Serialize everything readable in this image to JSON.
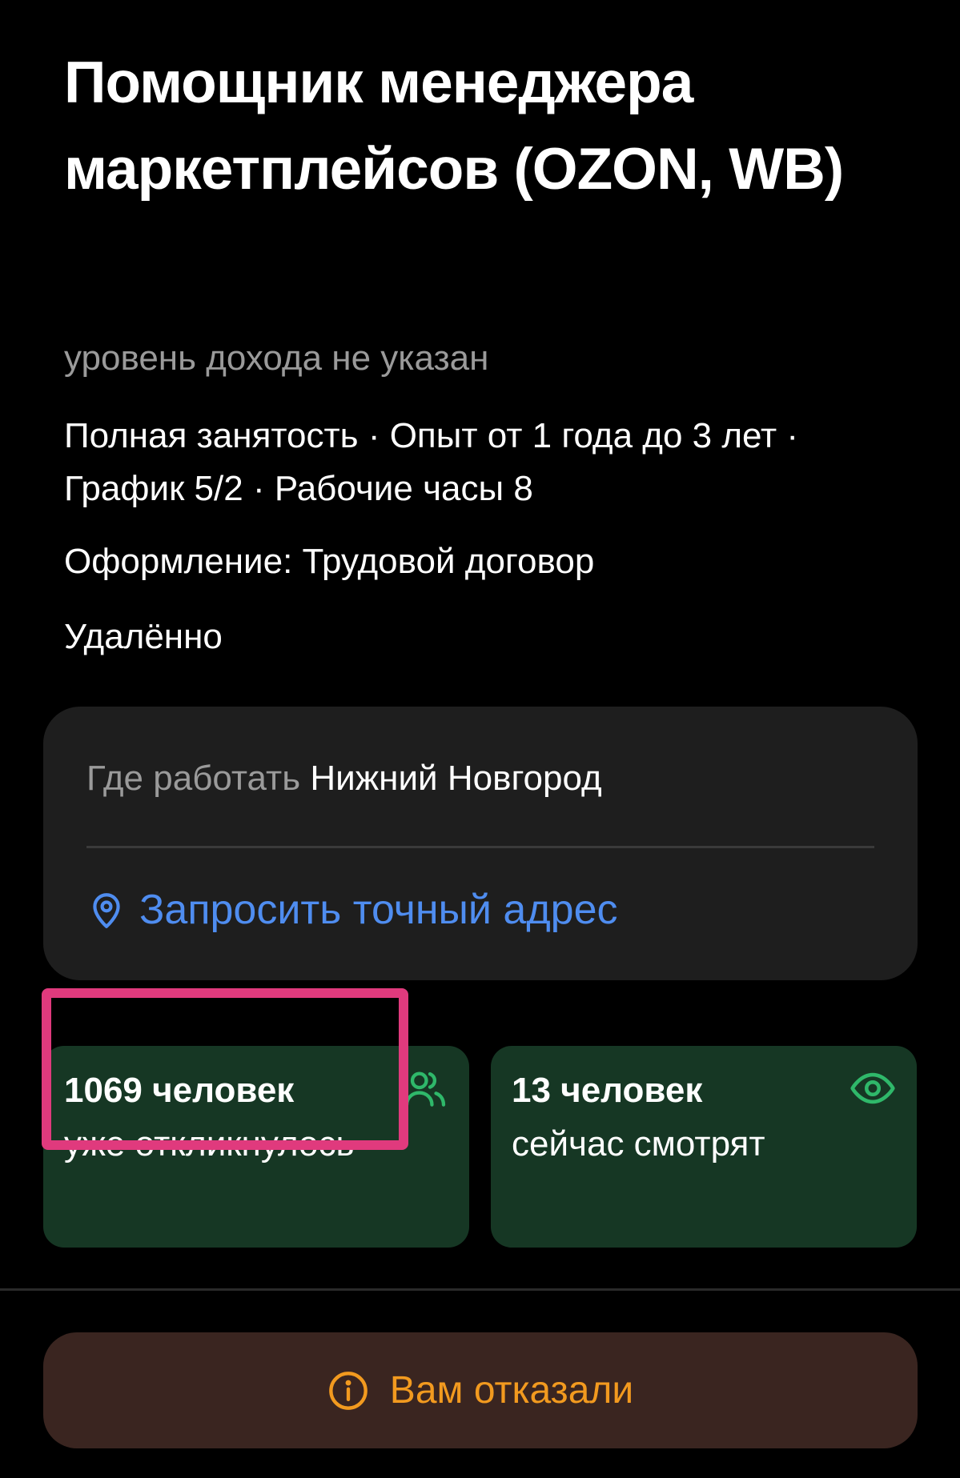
{
  "vacancy": {
    "title": "Помощник менеджера маркетплейсов (OZON, WB)",
    "salary": "уровень дохода не указан",
    "details": "Полная занятость · Опыт от 1 года до 3 лет · График 5/2 · Рабочие часы 8",
    "contract": "Оформление: Трудовой договор",
    "remote": "Удалённо"
  },
  "location": {
    "label": "Где работать",
    "city": "Нижний Новгород",
    "request_link": "Запросить точный адрес",
    "icon": "map-pin-icon"
  },
  "stats": {
    "responses": {
      "count": "1069 человек",
      "text": "уже откликнулось",
      "icon": "people-icon"
    },
    "viewers": {
      "count": "13 человек",
      "text": "сейчас смотрят",
      "icon": "eye-icon"
    }
  },
  "status": {
    "label": "Вам отказали",
    "icon": "info-icon"
  },
  "colors": {
    "background": "#000000",
    "card": "#1e1e1e",
    "stat_card": "#163724",
    "accent_green": "#2fb86a",
    "link_blue": "#4f8df0",
    "status_orange": "#f29a1f",
    "status_bg": "#3a2520",
    "highlight": "#e03a7d"
  }
}
